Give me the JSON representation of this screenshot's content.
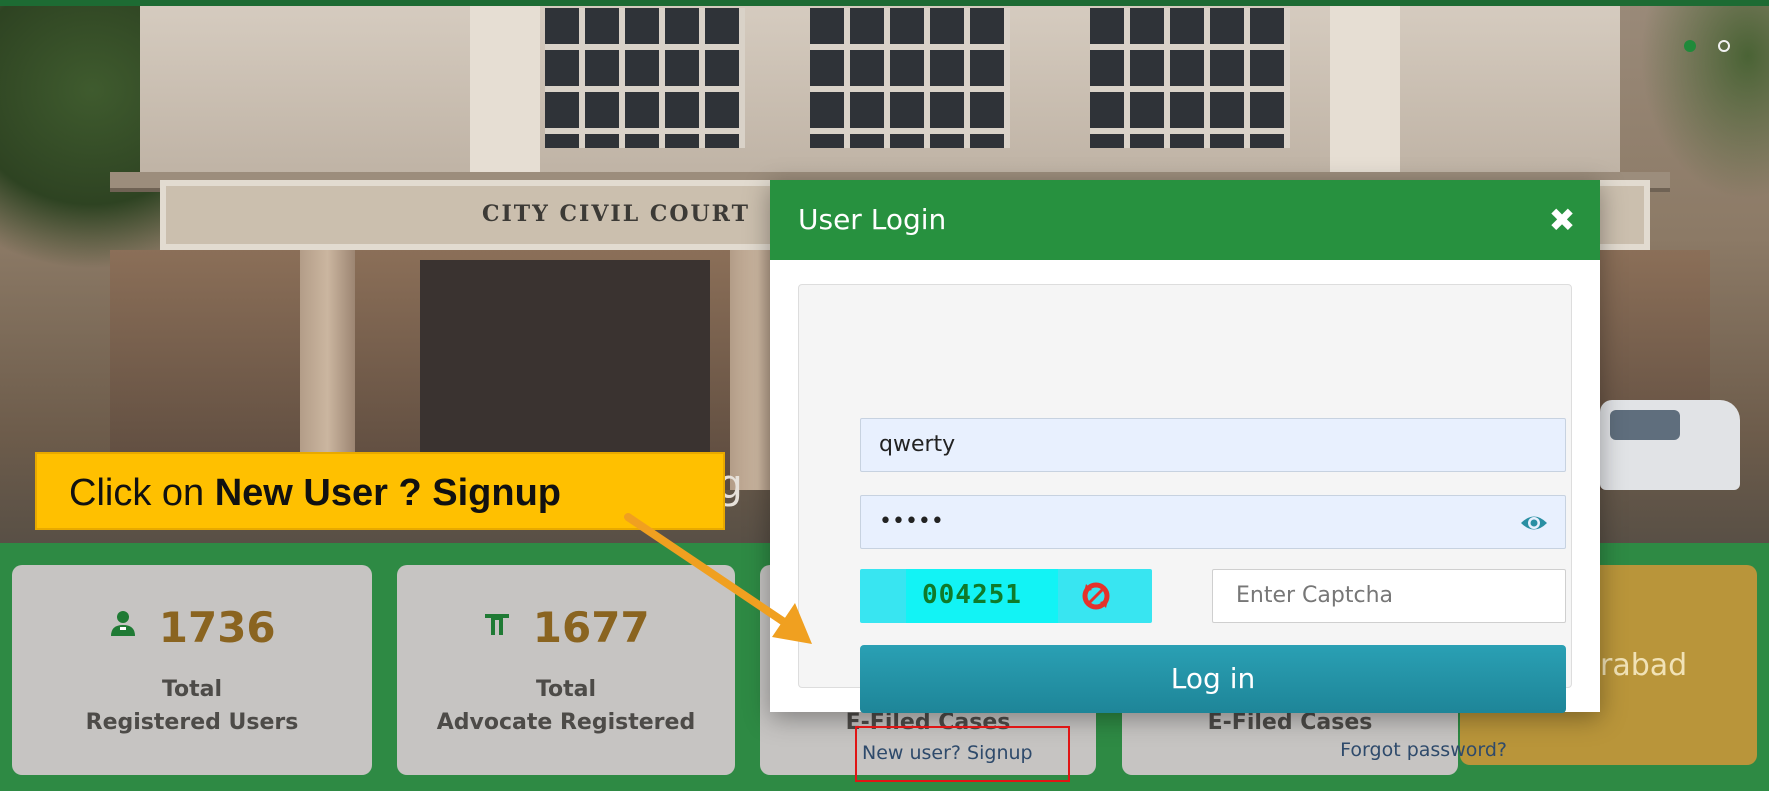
{
  "background": {
    "sign_text": "CITY CIVIL COURT",
    "heading_fragment": "ng"
  },
  "stats": [
    {
      "icon": "user-icon",
      "value": "1736",
      "label_line1": "Total",
      "label_line2": "Registered Users"
    },
    {
      "icon": "advocate-icon",
      "value": "1677",
      "label_line1": "Total",
      "label_line2": "Advocate Registered"
    },
    {
      "label_line2": "E-Filed Cases"
    },
    {
      "label_line2": "E-Filed Cases"
    },
    {
      "partial_text": "rabad"
    }
  ],
  "callout": {
    "prefix": "Click on ",
    "bold": "New User ? Signup",
    "color": "#ffc000"
  },
  "modal": {
    "title": "User Login",
    "close_symbol": "✖",
    "username_value": "qwerty",
    "password_value": "•••••",
    "captcha_code": "004251",
    "captcha_placeholder": "Enter Captcha",
    "login_label": "Log in",
    "signup_label": "New user? Signup",
    "forgot_label": "Forgot password?",
    "header_color": "#27913f",
    "button_color": "#2396a9"
  },
  "carousel": {
    "active_index": 0,
    "count": 2
  }
}
